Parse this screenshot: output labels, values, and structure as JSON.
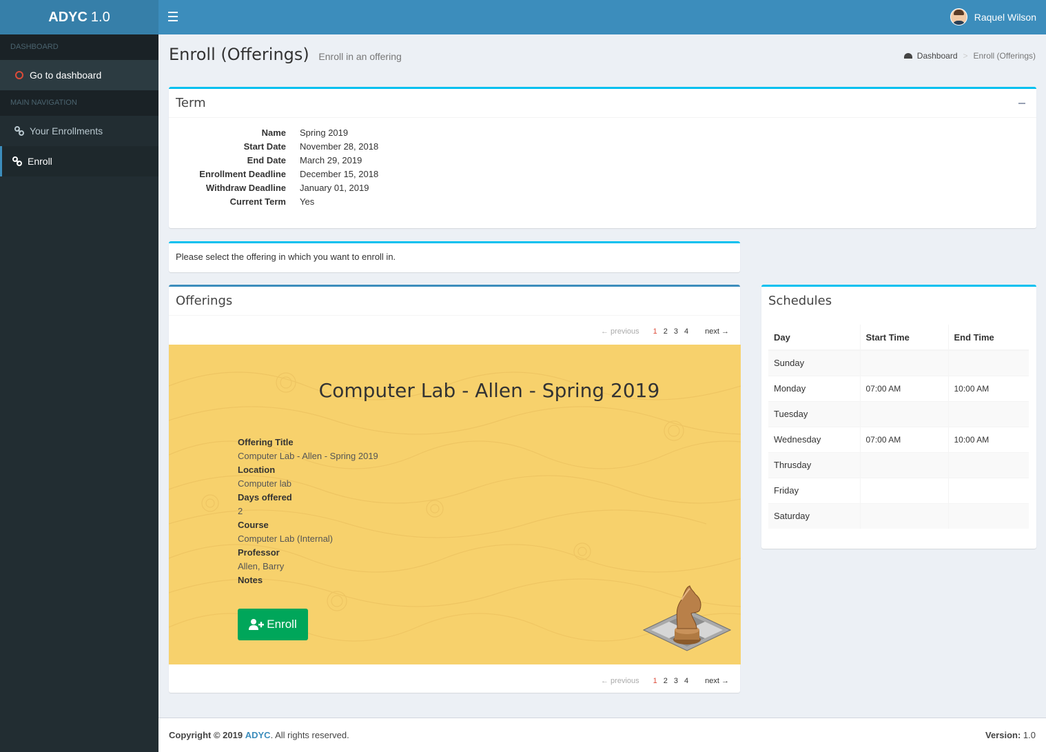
{
  "app": {
    "logo_bold": "ADYC",
    "logo_version": "1.0"
  },
  "sidebar": {
    "header_dashboard": "DASHBOARD",
    "dashboard_item": "Go to dashboard",
    "header_main": "MAIN NAVIGATION",
    "items": [
      {
        "label": "Your Enrollments",
        "icon": "link-icon"
      },
      {
        "label": "Enroll",
        "icon": "link-icon",
        "active": true
      }
    ]
  },
  "topbar": {
    "user_name": "Raquel Wilson"
  },
  "page": {
    "title": "Enroll (Offerings)",
    "subtitle": "Enroll in an offering"
  },
  "breadcrumb": {
    "home": "Dashboard",
    "current": "Enroll (Offerings)"
  },
  "term": {
    "title": "Term",
    "rows": [
      {
        "label": "Name",
        "value": "Spring 2019"
      },
      {
        "label": "Start Date",
        "value": "November 28, 2018"
      },
      {
        "label": "End Date",
        "value": "March 29, 2019"
      },
      {
        "label": "Enrollment Deadline",
        "value": "December 15, 2018"
      },
      {
        "label": "Withdraw Deadline",
        "value": "January 01, 2019"
      },
      {
        "label": "Current Term",
        "value": "Yes"
      }
    ]
  },
  "notice": {
    "text": "Please select the offering in which you want to enroll in."
  },
  "offerings": {
    "title": "Offerings",
    "pager": {
      "previous": "← previous",
      "pages": [
        "1",
        "2",
        "3",
        "4"
      ],
      "current": "1",
      "next": "next →"
    },
    "card": {
      "heading": "Computer Lab - Allen - Spring 2019",
      "fields": [
        {
          "label": "Offering Title",
          "value": "Computer Lab - Allen - Spring 2019"
        },
        {
          "label": "Location",
          "value": "Computer lab"
        },
        {
          "label": "Days offered",
          "value": "2"
        },
        {
          "label": "Course",
          "value": "Computer Lab (Internal)"
        },
        {
          "label": "Professor",
          "value": "Allen, Barry"
        },
        {
          "label": "Notes",
          "value": ""
        }
      ],
      "enroll_label": "Enroll"
    }
  },
  "schedules": {
    "title": "Schedules",
    "columns": [
      "Day",
      "Start Time",
      "End Time"
    ],
    "rows": [
      {
        "day": "Sunday",
        "start": "",
        "end": ""
      },
      {
        "day": "Monday",
        "start": "07:00 AM",
        "end": "10:00 AM"
      },
      {
        "day": "Tuesday",
        "start": "",
        "end": ""
      },
      {
        "day": "Wednesday",
        "start": "07:00 AM",
        "end": "10:00 AM"
      },
      {
        "day": "Thrusday",
        "start": "",
        "end": ""
      },
      {
        "day": "Friday",
        "start": "",
        "end": ""
      },
      {
        "day": "Saturday",
        "start": "",
        "end": ""
      }
    ]
  },
  "footer": {
    "copyright_prefix": "Copyright © 2019",
    "brand": "ADYC",
    "rights": ". All rights reserved.",
    "version_label": "Version:",
    "version": "1.0"
  },
  "colors": {
    "topbar": "#3c8dbc",
    "logo_bg": "#367fa9",
    "sidebar": "#222d32",
    "accent_info": "#00c0ef",
    "enroll_green": "#00a65a",
    "card_bg": "#f7d16c"
  }
}
